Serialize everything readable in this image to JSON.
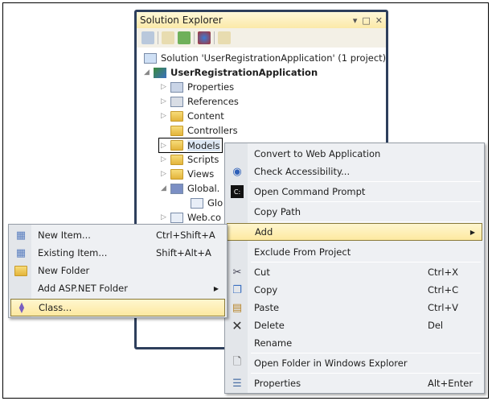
{
  "solution_explorer": {
    "title": "Solution Explorer",
    "title_controls": [
      "▾",
      "□",
      "✕"
    ],
    "tree": [
      {
        "label": "Solution 'UserRegistrationApplication' (1 project)",
        "icon": "solution-icon",
        "level": 0
      },
      {
        "label": "UserRegistrationApplication",
        "icon": "csharp-web-project-icon",
        "level": 1,
        "expanded": true
      },
      {
        "label": "Properties",
        "icon": "properties-icon",
        "level": 2
      },
      {
        "label": "References",
        "icon": "references-icon",
        "level": 2
      },
      {
        "label": "Content",
        "icon": "folder-icon",
        "level": 2
      },
      {
        "label": "Controllers",
        "icon": "folder-icon",
        "level": 2
      },
      {
        "label": "Models",
        "icon": "folder-icon",
        "level": 2,
        "selected": true
      },
      {
        "label": "Scripts",
        "icon": "folder-icon",
        "level": 2
      },
      {
        "label": "Views",
        "icon": "folder-icon",
        "level": 2
      },
      {
        "label": "Global.",
        "icon": "global-asax-icon",
        "level": 2,
        "expanded": true
      },
      {
        "label": "Glo",
        "icon": "code-file-icon",
        "level": 3
      },
      {
        "label": "Web.co",
        "icon": "config-file-icon",
        "level": 2
      }
    ]
  },
  "context_menu": {
    "items": [
      {
        "label": "Convert to Web Application",
        "shortcut": ""
      },
      {
        "label": "Check Accessibility...",
        "shortcut": ""
      },
      {
        "label": "Open Command Prompt",
        "shortcut": ""
      },
      {
        "label": "Copy Path",
        "shortcut": ""
      },
      {
        "label": "Add",
        "shortcut": ""
      },
      {
        "label": "Exclude From Project",
        "shortcut": ""
      },
      {
        "label": "Cut",
        "shortcut": "Ctrl+X"
      },
      {
        "label": "Copy",
        "shortcut": "Ctrl+C"
      },
      {
        "label": "Paste",
        "shortcut": "Ctrl+V"
      },
      {
        "label": "Delete",
        "shortcut": "Del"
      },
      {
        "label": "Rename",
        "shortcut": ""
      },
      {
        "label": "Open Folder in Windows Explorer",
        "shortcut": ""
      },
      {
        "label": "Properties",
        "shortcut": "Alt+Enter"
      }
    ]
  },
  "add_submenu": {
    "items": [
      {
        "label": "New Item...",
        "shortcut": "Ctrl+Shift+A"
      },
      {
        "label": "Existing Item...",
        "shortcut": "Shift+Alt+A"
      },
      {
        "label": "New Folder",
        "shortcut": ""
      },
      {
        "label": "Add ASP.NET Folder",
        "shortcut": ""
      },
      {
        "label": "Class...",
        "shortcut": ""
      }
    ]
  }
}
